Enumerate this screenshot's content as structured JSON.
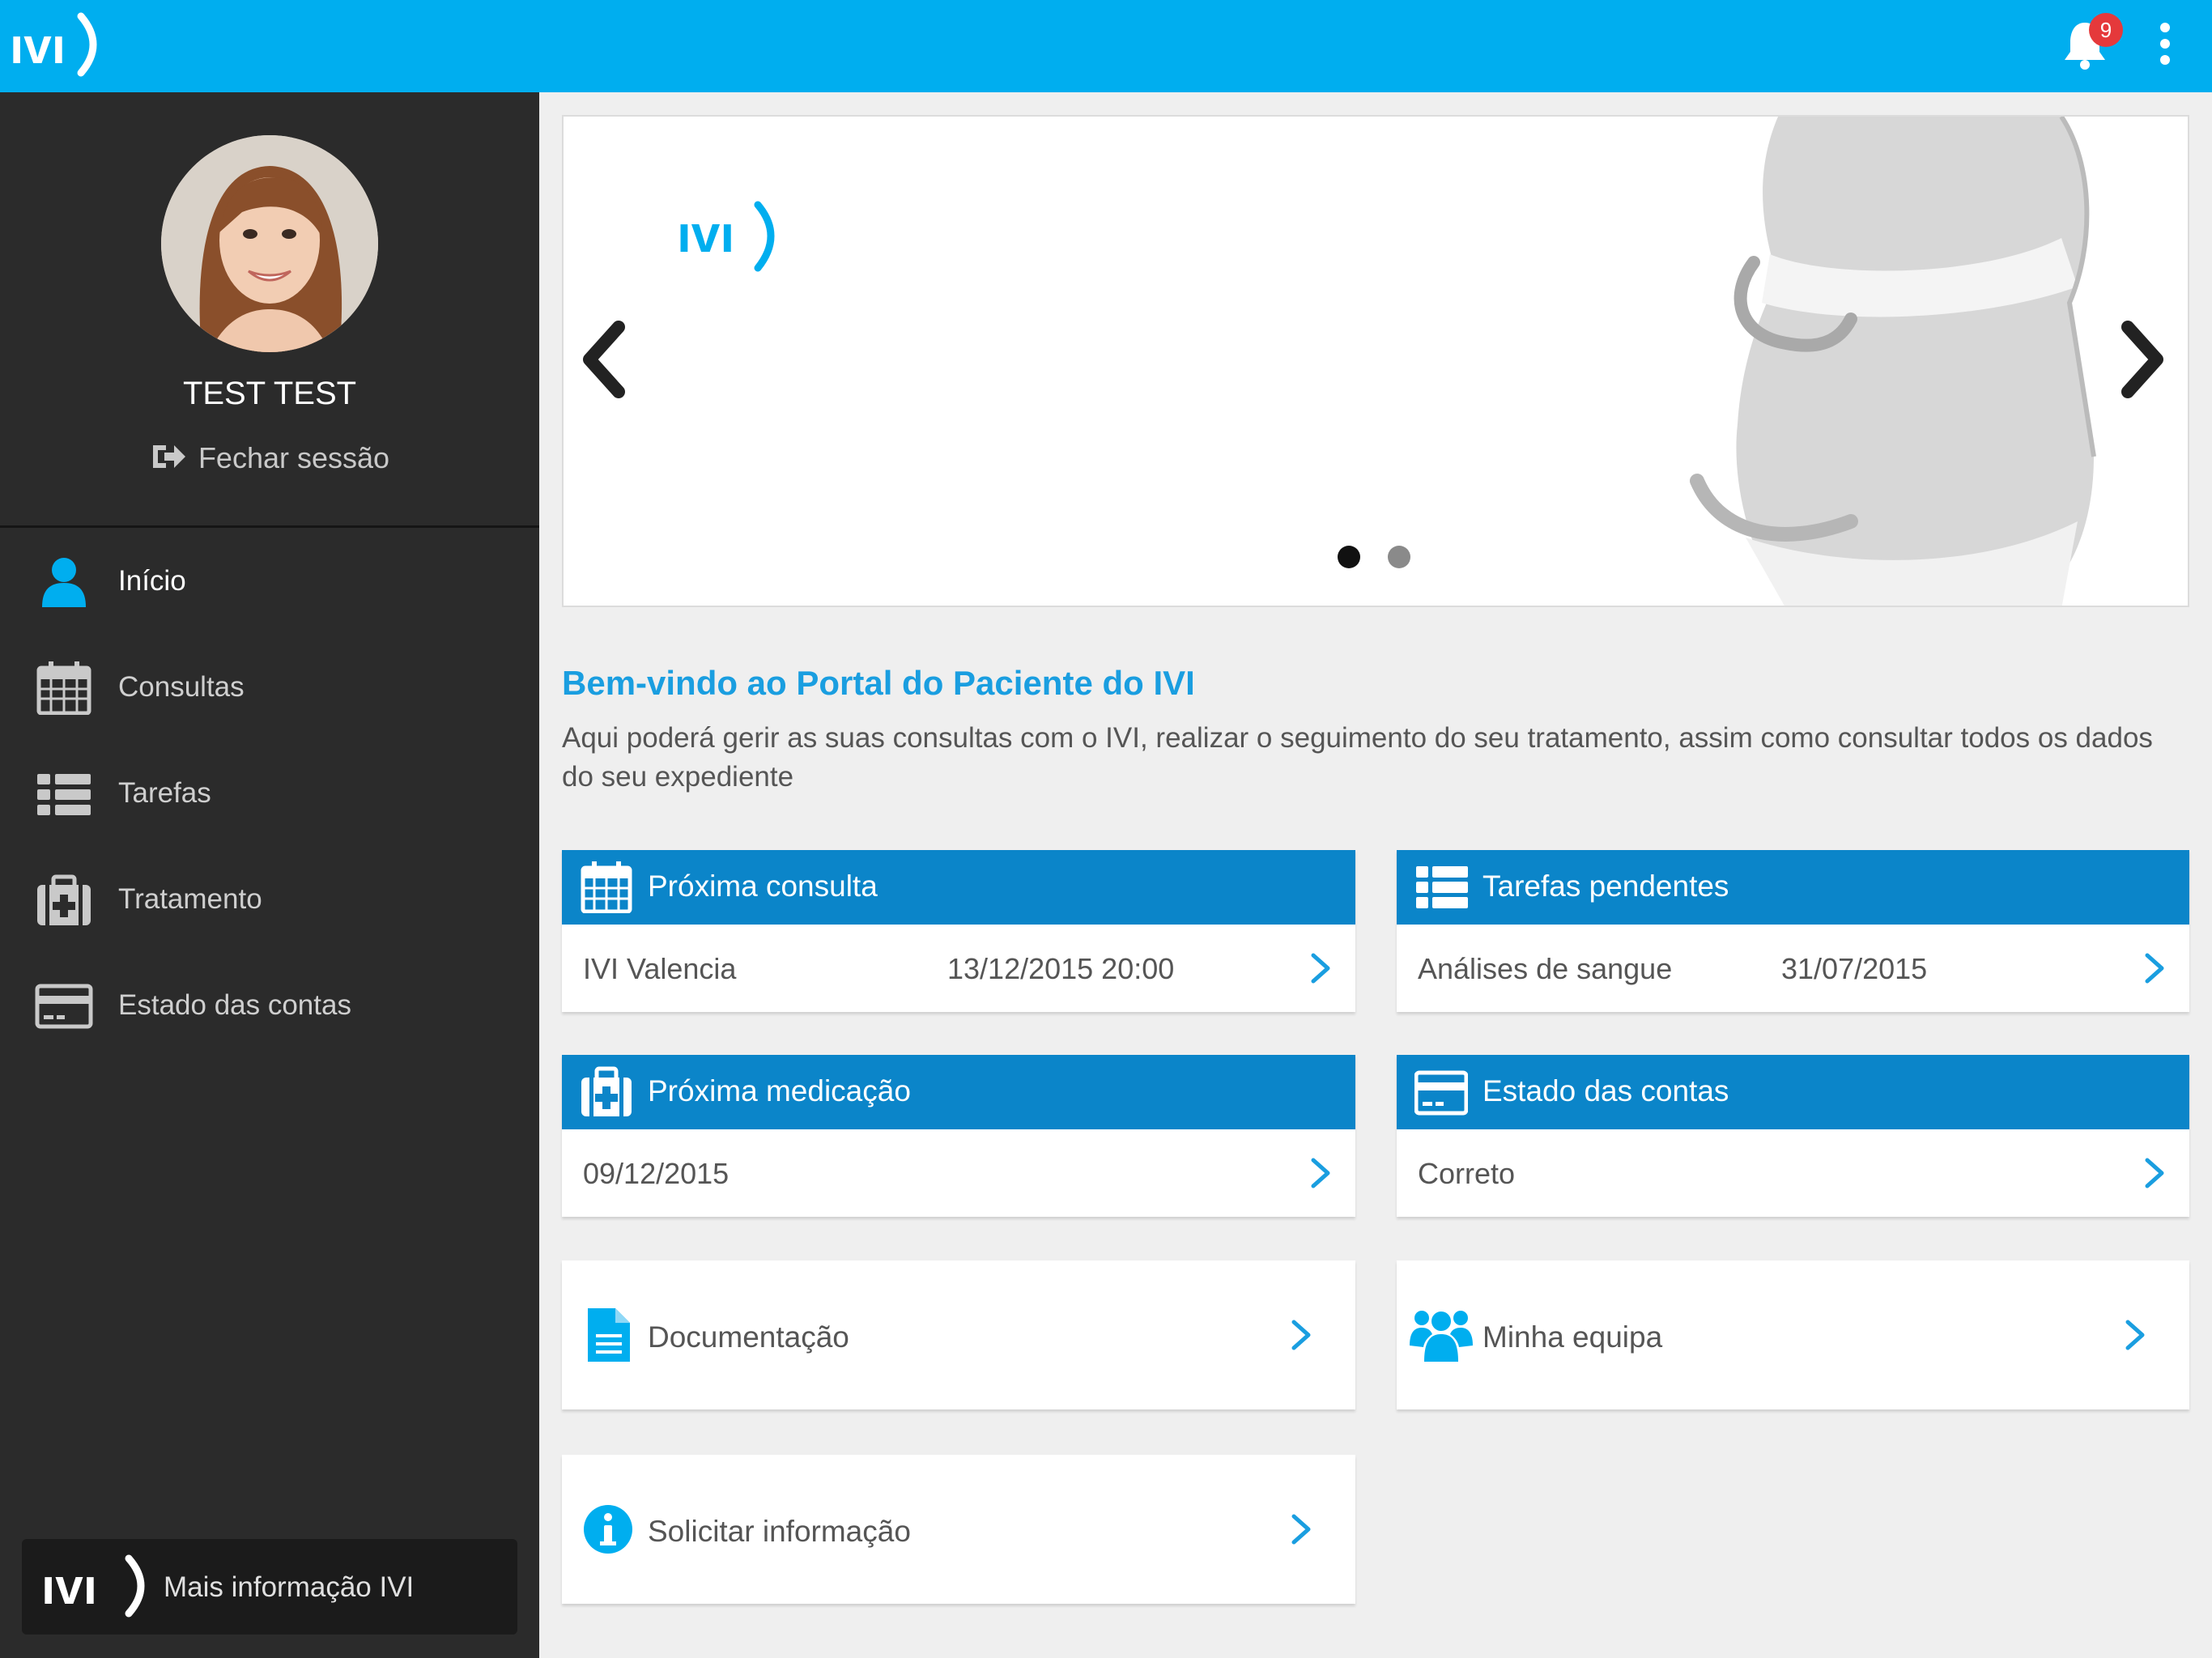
{
  "colors": {
    "accent": "#00aeef",
    "card_header": "#0b85c9",
    "sidebar_bg": "#2b2b2b",
    "link_blue": "#1a9ee0",
    "badge_red": "#e5393b"
  },
  "header": {
    "logo": "ivi",
    "notification_count": "9",
    "icons": [
      "bell-icon",
      "kebab-menu-icon"
    ]
  },
  "profile": {
    "name": "TEST TEST",
    "logout_label": "Fechar sessão"
  },
  "sidebar": {
    "items": [
      {
        "label": "Início",
        "icon": "user-icon",
        "active": true
      },
      {
        "label": "Consultas",
        "icon": "calendar-icon",
        "active": false
      },
      {
        "label": "Tarefas",
        "icon": "list-icon",
        "active": false
      },
      {
        "label": "Tratamento",
        "icon": "medkit-icon",
        "active": false
      },
      {
        "label": "Estado das contas",
        "icon": "credit-card-icon",
        "active": false
      }
    ],
    "more_info_label": "Mais informação IVI",
    "more_info_logo": "ivi"
  },
  "banner": {
    "logo": "ivi",
    "slide_count": 2,
    "active_slide": 1
  },
  "welcome": {
    "title": "Bem-vindo ao Portal do Paciente do IVI",
    "text": "Aqui poderá gerir as suas consultas com o IVI, realizar o seguimento do seu tratamento, assim como consultar todos os dados do seu expediente"
  },
  "cards": {
    "next_appointment": {
      "title": "Próxima consulta",
      "place": "IVI Valencia",
      "datetime": "13/12/2015 20:00",
      "icon": "calendar-icon"
    },
    "pending_tasks": {
      "title": "Tarefas pendentes",
      "task": "Análises de sangue",
      "date": "31/07/2015",
      "icon": "list-icon"
    },
    "next_medication": {
      "title": "Próxima medicação",
      "date": "09/12/2015",
      "icon": "medkit-icon"
    },
    "account_status": {
      "title": "Estado das contas",
      "status": "Correto",
      "icon": "credit-card-icon"
    },
    "documentation": {
      "title": "Documentação",
      "icon": "document-icon"
    },
    "my_team": {
      "title": "Minha equipa",
      "icon": "team-icon"
    },
    "request_info": {
      "title": "Solicitar informação",
      "icon": "info-icon"
    }
  }
}
